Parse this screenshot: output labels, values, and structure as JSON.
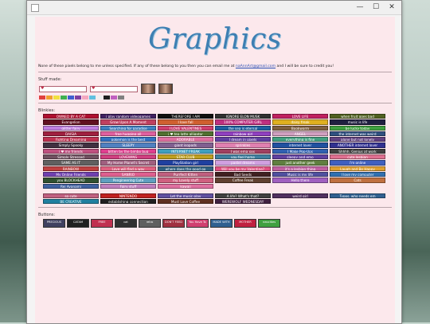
{
  "page": {
    "logo": "Graphics",
    "notice_text": "None of these pixels belong to me unless specified. If any of these belong to you then you can email me at ",
    "notice_email": "naAnnArt@gmail.com",
    "notice_tail": " and I will be sure to credit you!",
    "stuff_heading": "Stuff made:",
    "blinkies_heading": "Blinkies:",
    "buttons_heading": "Buttons:"
  },
  "window": {
    "minimize": "—",
    "maximize": "☐",
    "close": "✕"
  },
  "flags": [
    "#e04040",
    "#f0a030",
    "#f0e040",
    "#40b050",
    "#4060d0",
    "#8040a0",
    "#f4a8c0",
    "#60c0e0",
    "#f0f0f0",
    "#202020",
    "#c060c0",
    "#808080"
  ],
  "blinkies": [
    {
      "text": "OWNED BY A CAT",
      "color": "#b01030"
    },
    {
      "text": "i play random videogames",
      "color": "#402060"
    },
    {
      "text": "THEREFORE I AM",
      "color": "#101010"
    },
    {
      "text": "IGNORE ELON MUSK",
      "color": "#303030"
    },
    {
      "text": "LOVE LIFE",
      "color": "#c02060"
    },
    {
      "text": "when fruit goes bad",
      "color": "#506020"
    },
    {
      "text": "Evangelion",
      "color": "#601020"
    },
    {
      "text": "Grow Upon A Moment",
      "color": "#c04060"
    },
    {
      "text": "I love fall",
      "color": "#d06030"
    },
    {
      "text": "100% COMPUTER GIRL",
      "color": "#c03080"
    },
    {
      "text": "daisy freak",
      "color": "#e0b020"
    },
    {
      "text": "music is life",
      "color": "#202040"
    },
    {
      "text": "glitter fairy",
      "color": "#c080e0"
    },
    {
      "text": "Searching for paradise",
      "color": "#4080c0"
    },
    {
      "text": "I LOVE VALENTINES",
      "color": "#d04070"
    },
    {
      "text": "the sea is eternal",
      "color": "#2060a0"
    },
    {
      "text": "Bookworm",
      "color": "#806040"
    },
    {
      "text": "be lucky today",
      "color": "#40a040"
    },
    {
      "text": "DAISIA",
      "color": "#a02040"
    },
    {
      "text": "free hugging all",
      "color": "#e060a0"
    },
    {
      "text": "i ♥ tea latte alligator",
      "color": "#507030"
    },
    {
      "text": "rainbow girl",
      "color": "#9040c0"
    },
    {
      "text": "ANGEL",
      "color": "#d0a0c0"
    },
    {
      "text": "the internet was weird",
      "color": "#305080"
    },
    {
      "text": "Fighting Dreaming",
      "color": "#c03050"
    },
    {
      "text": "pokemon is the best",
      "color": "#3070c0"
    },
    {
      "text": "ADORABLE",
      "color": "#e070a0"
    },
    {
      "text": "I dream in pixels",
      "color": "#6040a0"
    },
    {
      "text": "everything is fine",
      "color": "#40a080"
    },
    {
      "text": "alone but not lonely",
      "color": "#604080"
    },
    {
      "text": "Simply Spooky",
      "color": "#403040"
    },
    {
      "text": "SLEEPY",
      "color": "#5080c0"
    },
    {
      "text": "giant isopods",
      "color": "#806090"
    },
    {
      "text": "sprinkles",
      "color": "#e080b0"
    },
    {
      "text": "internet lover",
      "color": "#2050a0"
    },
    {
      "text": "ANOTHER internet lover",
      "color": "#303090"
    },
    {
      "text": "i ♥ my friends",
      "color": "#c05080"
    },
    {
      "text": "bitten by the bimbo bug",
      "color": "#e04090"
    },
    {
      "text": "INTERNET FREAK",
      "color": "#40a0c0"
    },
    {
      "text": "I was ema xxx",
      "color": "#a04060"
    },
    {
      "text": "I Make Pop-Ups",
      "color": "#3060b0"
    },
    {
      "text": "Shhhh, Genius at work",
      "color": "#404040"
    },
    {
      "text": "Simply Stressed",
      "color": "#705060"
    },
    {
      "text": "LOVEWINS",
      "color": "#d04080"
    },
    {
      "text": "STAR CLUB",
      "color": "#c0a020"
    },
    {
      "text": "you feel home",
      "color": "#4080a0"
    },
    {
      "text": "sleepy and emo",
      "color": "#6040a0"
    },
    {
      "text": "cute lesbian",
      "color": "#e07090"
    },
    {
      "text": "SAME AS IT",
      "color": "#606060"
    },
    {
      "text": "My Home Planet's Secret",
      "color": "#a06080"
    },
    {
      "text": "PlayStation girl",
      "color": "#2040a0"
    },
    {
      "text": "pastel dreams",
      "color": "#d0a0e0"
    },
    {
      "text": "just another geek",
      "color": "#608040"
    },
    {
      "text": "i'm online",
      "color": "#4060c0"
    },
    {
      "text": "RAINBOW",
      "color": "#c04040"
    },
    {
      "text": "Love will find a way",
      "color": "#e06080"
    },
    {
      "text": "where does the good go",
      "color": "#306080"
    },
    {
      "text": "Will you be my Valentine?",
      "color": "#e05080"
    },
    {
      "text": "it's a lesbian thing",
      "color": "#c060a0"
    },
    {
      "text": "Laugh and Be Happy",
      "color": "#e0a030"
    },
    {
      "text": "My Online Friends",
      "color": "#7040b0"
    },
    {
      "text": "SANRIO",
      "color": "#e06090"
    },
    {
      "text": "Purrfect Kitten",
      "color": "#c06080"
    },
    {
      "text": "Bad Seeds",
      "color": "#402020"
    },
    {
      "text": "Music is my life",
      "color": "#5050a0"
    },
    {
      "text": "I love my computer",
      "color": "#3070b0"
    },
    {
      "text": "you BLOCKHEAD",
      "color": "#305030"
    },
    {
      "text": "Pengineering Cute",
      "color": "#60a0c0"
    },
    {
      "text": "my Lovely stuff",
      "color": "#d06080"
    },
    {
      "text": "Coffee Freak",
      "color": "#604030"
    },
    {
      "text": "Hello there",
      "color": "#a060c0"
    },
    {
      "text": "Cats",
      "color": "#c07040"
    },
    {
      "text": "Rei Ayanami",
      "color": "#4060a0"
    },
    {
      "text": "Fairy stuff",
      "color": "#c080c0"
    },
    {
      "text": "kawaii",
      "color": "#e070a0"
    }
  ],
  "blinkies2": [
    {
      "text": "so cute",
      "color": "#c06080"
    },
    {
      "text": "NINTENDO",
      "color": "#c02020"
    },
    {
      "text": "Let the music play",
      "color": "#6050a0"
    },
    {
      "text": "A life? What's that?",
      "color": "#404040"
    },
    {
      "text": "weird girl",
      "color": "#503060"
    },
    {
      "text": "Typos, who needs em",
      "color": "#306090"
    },
    {
      "text": "BE CREATIVE",
      "color": "#2080a0"
    },
    {
      "text": "establishing connection",
      "color": "#202020"
    },
    {
      "text": "Must Love Coffee",
      "color": "#603020"
    },
    {
      "text": "WEREWOLF WEDNESDAY",
      "color": "#402040"
    }
  ],
  "buttons": [
    {
      "text": "PRECIOUS",
      "color": "#404060"
    },
    {
      "text": "CATAM",
      "color": "#202020"
    },
    {
      "text": "FREE",
      "color": "#c03050"
    },
    {
      "text": "cat",
      "color": "#303030"
    },
    {
      "text": "retro",
      "color": "#606060"
    },
    {
      "text": "DON'T FEED",
      "color": "#a03040"
    },
    {
      "text": "You Have To",
      "color": "#d04070"
    },
    {
      "text": "MADE WITH",
      "color": "#306090"
    },
    {
      "text": "MOTHER",
      "color": "#c02040"
    },
    {
      "text": "neocities",
      "color": "#40a040"
    }
  ]
}
